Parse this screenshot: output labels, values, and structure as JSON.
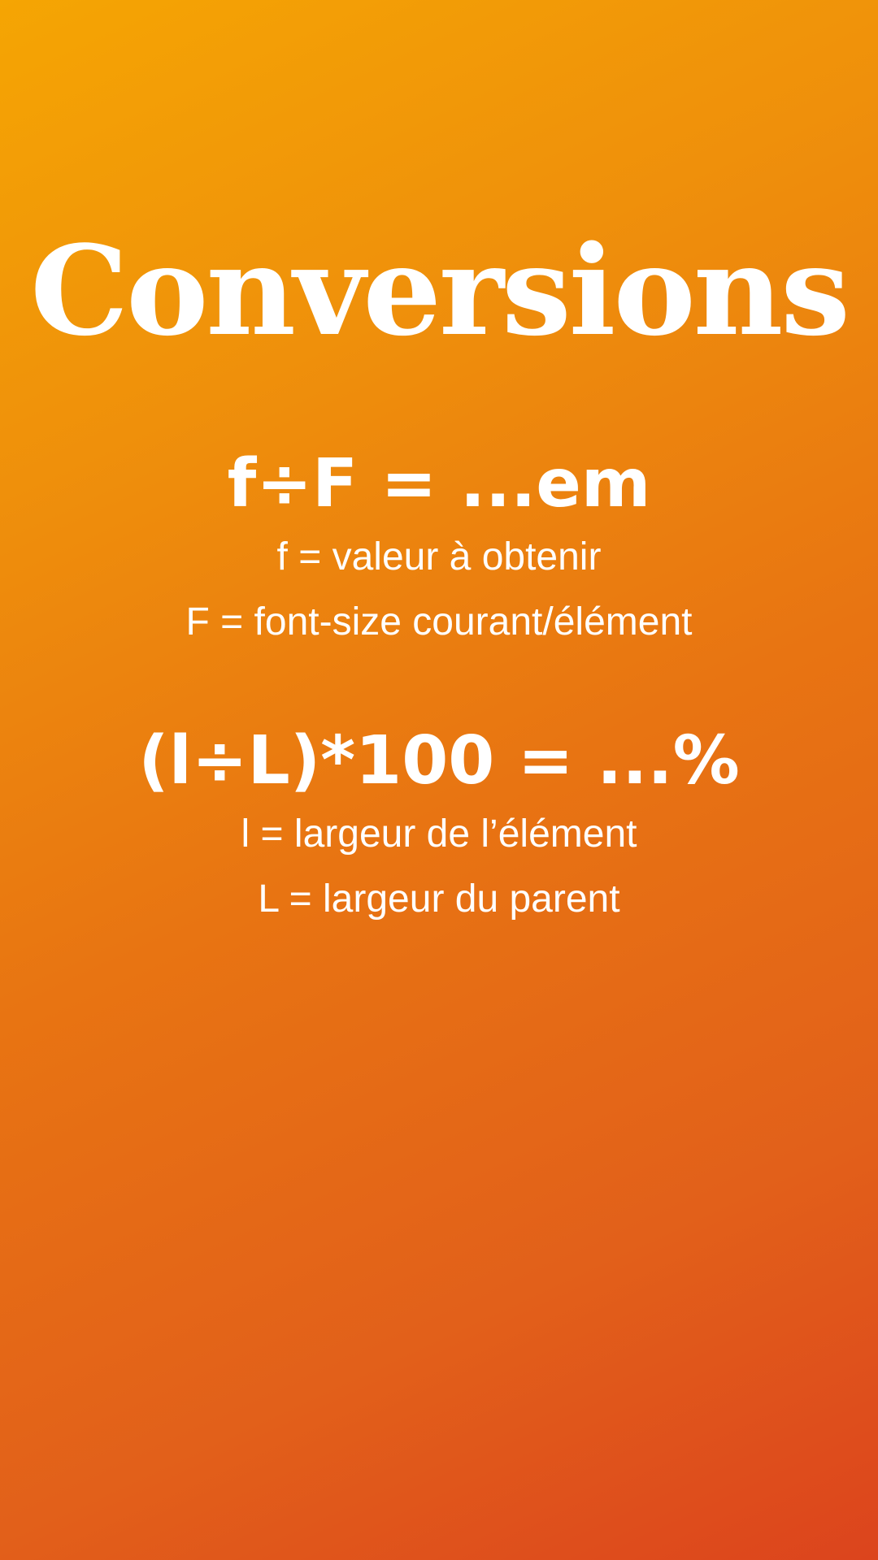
{
  "title": "Conversions",
  "formulas": [
    {
      "expression": "f÷F = ...em",
      "legend": [
        "f = valeur à obtenir",
        "F = font-size courant/élément"
      ]
    },
    {
      "expression": "(l÷L)*100 = ...%",
      "legend": [
        "l = largeur de l’élément",
        "L = largeur du parent"
      ]
    }
  ],
  "colors": {
    "gradient_start": "#f5a503",
    "gradient_end": "#dc441d",
    "text": "#ffffff"
  }
}
